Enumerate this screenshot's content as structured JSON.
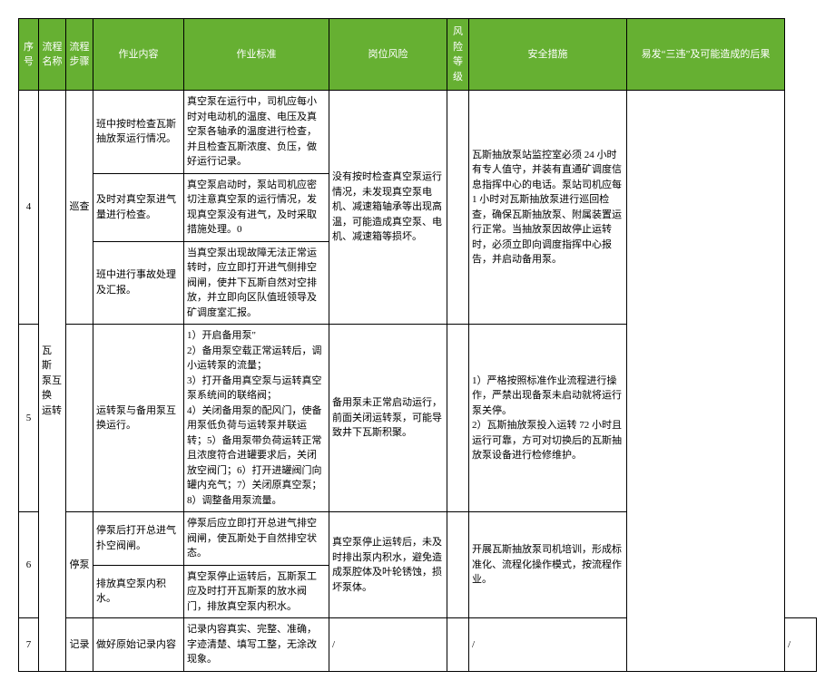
{
  "headers": {
    "seq": "序号",
    "name": "流程名称",
    "step": "流程步骤",
    "work": "作业内容",
    "std": "作业标准",
    "risk": "岗位风险",
    "lvl": "风险等级",
    "safe": "安全措施",
    "cons": "易发“三违”及可能造成的后果"
  },
  "r4": {
    "seq": "4",
    "step": "巡查",
    "work1": "班中按时检查瓦斯抽放泵运行情况。",
    "std1": "真空泵在运行中，司机应每小时对电动机的温度、电压及真空泵各轴承的温度进行检查，并且检查瓦斯浓度、负压，做好运行记录。",
    "work2": "及时对真空泵进气量进行检查。",
    "std2": "真空泵启动时，泵站司机应密切注意真空泵的运行情况，发现真空泵没有进气，及时采取措施处理。0",
    "work3": "班中进行事故处理及汇报。",
    "std3": "当真空泵出现故障无法正常运转时，应立即打开进气侧排空阀闸，使井下瓦斯自然对空排放，并立即向区队值班领导及矿调度室汇报。",
    "risk": "没有按时检查真空泵运行情况，未发现真空泵电机、减速箱轴承等出现高温，可能造成真空泵、电机、减速箱等损坏。",
    "safe": "瓦斯抽放泵站监控室必须 24 小时有专人值守，并装有直通矿调度信息指挥中心的电话。泵站司机应每 1 小时对瓦斯抽放泵进行巡回检查，确保瓦斯抽放泵、附属装置运行正常。当抽放泵因故停止运转时，必须立即向调度指挥中心报告，并启动备用泵。"
  },
  "r5": {
    "seq": "5",
    "name": "瓦 斯 泵互 换 运转",
    "step": "",
    "work": "运转泵与备用泵互换运行。",
    "std": "1）开启备用泵\"\n2）备用泵空载正常运转后，调小运转泵的流量；\n3）打开备用真空泵与运转真空泵系统间的联络阀；\n4）关闭备用泵的配风门，使备用泵低负荷与运转泵并联运转；5）备用泵带负荷运转正常且浓度符合进罐要求后，关闭放空阀门；6）打开进罐阀门向罐内充气；7）关闭原真空泵；8）调整备用泵流量。",
    "risk": "备用泵未正常启动运行，前面关闭运转泵，可能导致井下瓦斯积聚。",
    "safe": "1）严格按照标准作业流程进行操作，严禁出现备泵未启动就将运行泵关停。\n2）瓦斯抽放泵投入运转 72 小时且运行可靠，方可对切换后的瓦斯抽放泵设备进行检修维护。"
  },
  "r6": {
    "seq": "6",
    "step": "停泵",
    "work1": "停泵后打开总进气扑空阀闸。",
    "std1": "停泵后应立即打开总进气排空阀闸，使瓦斯处于自然排空状态。",
    "work2": "排放真空泵内积水。",
    "std2": "真空泵停止运转后，瓦斯泵工应及时打开瓦斯泵的放水阀门，排放真空泵内积水。",
    "risk": "真空泵停止运转后，未及时排出泵内积水，避免造成泵腔体及叶轮锈蚀，损坏泵体。",
    "safe": "开展瓦斯抽放泵司机培训，形成标准化、流程化操作模式，按流程作业。"
  },
  "r7": {
    "seq": "7",
    "step": "记录",
    "work": "做好原始记录内容",
    "std": "记录内容真实、完整、准确，字迹清楚、填写工整，无涂改现象。",
    "risk": "/",
    "safe": "/",
    "cons": "/"
  }
}
